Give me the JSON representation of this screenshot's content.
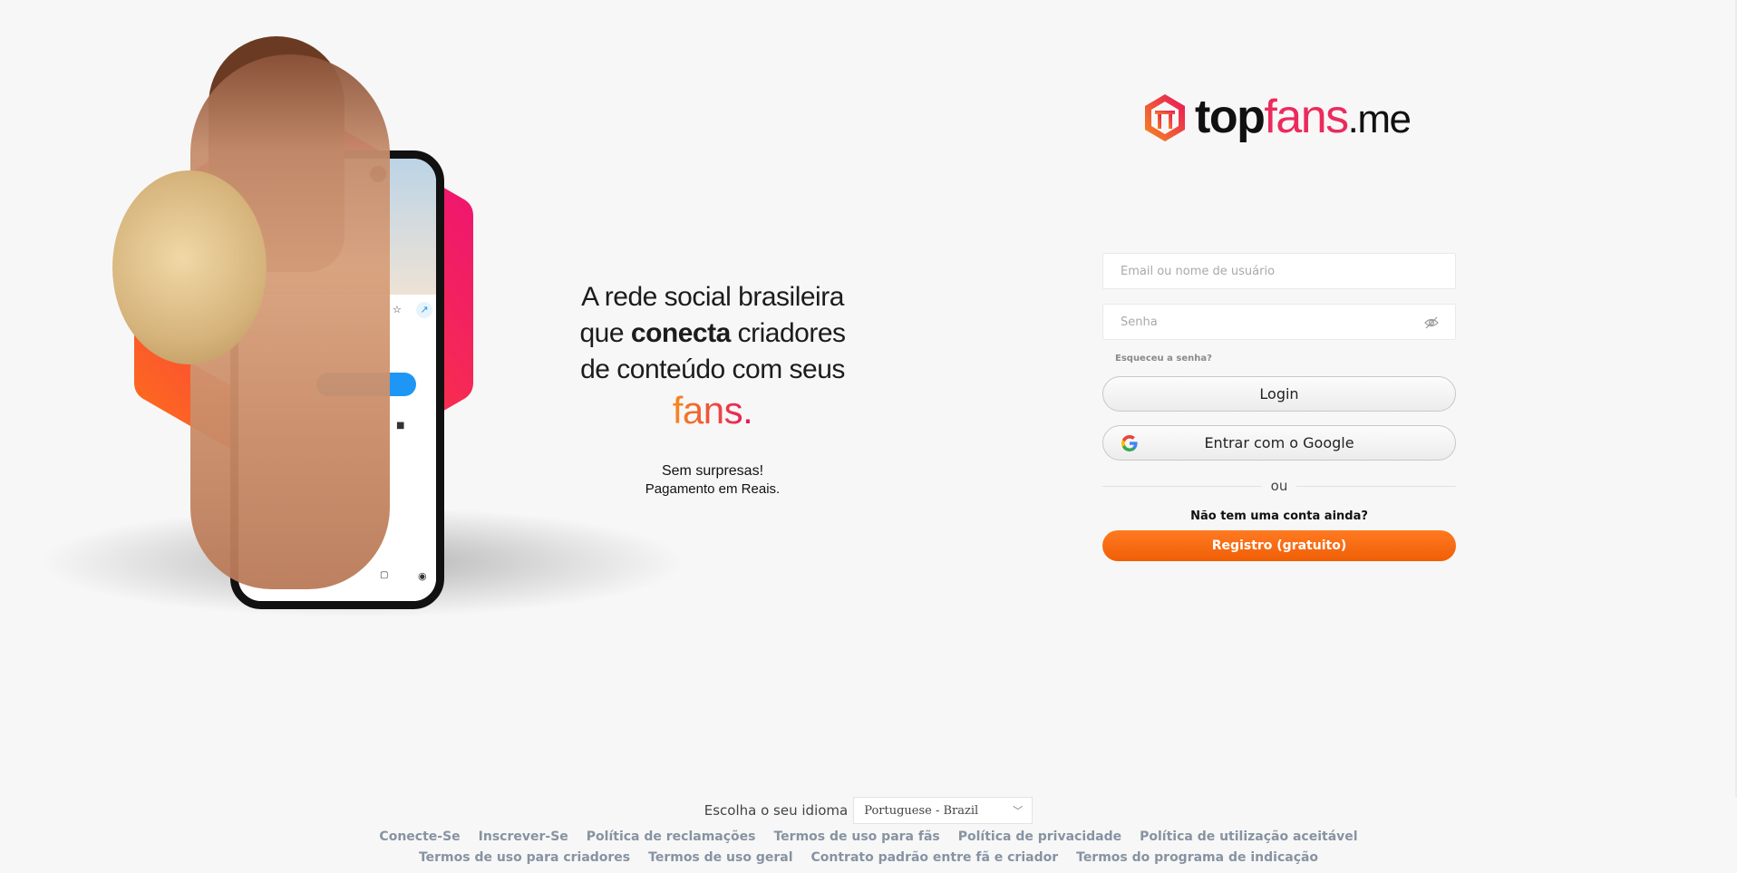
{
  "hero": {
    "tagline_line1": "A rede social brasileira",
    "tagline_line2_pre": "que ",
    "tagline_line2_bold": "conecta",
    "tagline_line2_post": " criadores",
    "tagline_line3": "de conteúdo com seus",
    "tagline_fans": "fans.",
    "sub_line1": "Sem surpresas!",
    "sub_line2": "Pagamento em Reais."
  },
  "logo": {
    "top": "top",
    "fans": "fans",
    "me": ".me"
  },
  "login_form": {
    "email_placeholder": "Email ou nome de usuário",
    "password_placeholder": "Senha",
    "forgot_label": "Esqueceu a senha?",
    "login_label": "Login",
    "google_label": "Entrar com o Google",
    "or_label": "ou",
    "no_account_label": "Não tem uma conta ainda?",
    "register_label": "Registro (gratuito)"
  },
  "language": {
    "label": "Escolha o seu idioma",
    "selected": "Portuguese - Brazil"
  },
  "footer": {
    "row1": [
      "Conecte-Se",
      "Inscrever-Se",
      "Política de reclamações",
      "Termos de uso para fãs",
      "Política de privacidade",
      "Política de utilização aceitável"
    ],
    "row2": [
      "Termos de uso para criadores",
      "Termos de uso geral",
      "Contrato padrão entre fã e criador",
      "Termos do programa de indicação"
    ]
  },
  "colors": {
    "brand_orange": "#f56a12",
    "brand_pink": "#ec2a5c",
    "link_gray": "#8793a2"
  }
}
